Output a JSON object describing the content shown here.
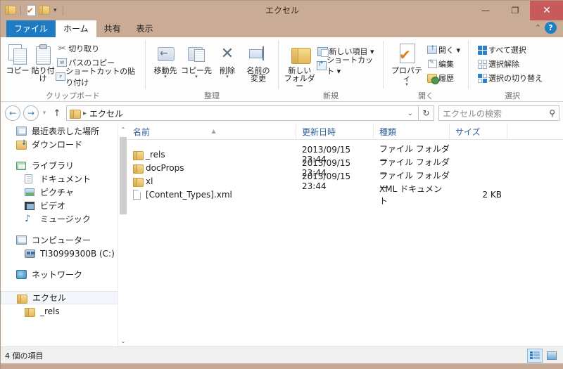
{
  "window": {
    "title": "エクセル",
    "controls": {
      "minimize": "—",
      "maximize": "❐",
      "close": "✕"
    },
    "quick_access": [
      "folder-icon",
      "properties-icon",
      "folder-icon",
      "customize-caret"
    ]
  },
  "tabs": [
    {
      "label": "ファイル",
      "active": false,
      "kind": "file"
    },
    {
      "label": "ホーム",
      "active": true,
      "kind": "normal"
    },
    {
      "label": "共有",
      "active": false,
      "kind": "normal"
    },
    {
      "label": "表示",
      "active": false,
      "kind": "normal"
    }
  ],
  "help_button": "?",
  "ribbon": {
    "groups": [
      {
        "label": "クリップボード",
        "big_buttons": [
          {
            "label": "コピー",
            "icon": "copy-icon"
          },
          {
            "label": "貼り付け",
            "icon": "clipboard-icon"
          }
        ],
        "small_buttons": [
          {
            "label": "切り取り",
            "icon": "scissors-icon"
          },
          {
            "label": "パスのコピー",
            "icon": "copy-path-icon"
          },
          {
            "label": "ショートカットの貼り付け",
            "icon": "paste-shortcut-icon"
          }
        ]
      },
      {
        "label": "整理",
        "big_buttons": [
          {
            "label": "移動先",
            "icon": "move-to-icon",
            "caret": true
          },
          {
            "label": "コピー先",
            "icon": "copy-to-icon",
            "caret": true
          },
          {
            "label": "削除",
            "icon": "delete-icon",
            "caret": true
          },
          {
            "label": "名前の\n変更",
            "icon": "rename-icon",
            "caret": false
          }
        ],
        "small_buttons": []
      },
      {
        "label": "新規",
        "big_buttons": [
          {
            "label": "新しい\nフォルダー",
            "icon": "new-folder-icon",
            "caret": false
          }
        ],
        "small_buttons": [
          {
            "label": "新しい項目 ▾",
            "icon": "new-item-icon"
          },
          {
            "label": "ショートカット ▾",
            "icon": "shortcut-icon"
          }
        ]
      },
      {
        "label": "開く",
        "big_buttons": [
          {
            "label": "プロパティ",
            "icon": "properties-icon",
            "caret": true
          }
        ],
        "small_buttons": [
          {
            "label": "開く ▾",
            "icon": "open-icon"
          },
          {
            "label": "編集",
            "icon": "edit-icon"
          },
          {
            "label": "履歴",
            "icon": "history-icon"
          }
        ]
      },
      {
        "label": "選択",
        "big_buttons": [],
        "small_buttons": [
          {
            "label": "すべて選択",
            "icon": "select-all-icon"
          },
          {
            "label": "選択解除",
            "icon": "select-none-icon"
          },
          {
            "label": "選択の切り替え",
            "icon": "invert-selection-icon"
          }
        ]
      }
    ]
  },
  "address_bar": {
    "back": "←",
    "forward": "→",
    "recent_caret": "▾",
    "up": "↑",
    "crumb_icon": "folder-icon",
    "crumb_sep": "▸",
    "path": "エクセル",
    "dropdown_caret": "⌄",
    "refresh": "↻"
  },
  "search": {
    "placeholder": "エクセルの検索",
    "icon": "magnifier-icon"
  },
  "nav_pane": {
    "items": [
      {
        "label": "最近表示した場所",
        "icon": "recent-places-icon",
        "level": 1,
        "selected": false
      },
      {
        "label": "ダウンロード",
        "icon": "downloads-icon",
        "level": 1,
        "selected": false
      },
      {
        "gap": true
      },
      {
        "label": "ライブラリ",
        "icon": "library-icon",
        "level": 1,
        "selected": false
      },
      {
        "label": "ドキュメント",
        "icon": "documents-icon",
        "level": 2,
        "selected": false
      },
      {
        "label": "ピクチャ",
        "icon": "pictures-icon",
        "level": 2,
        "selected": false
      },
      {
        "label": "ビデオ",
        "icon": "videos-icon",
        "level": 2,
        "selected": false
      },
      {
        "label": "ミュージック",
        "icon": "music-icon",
        "level": 2,
        "selected": false
      },
      {
        "gap": true
      },
      {
        "label": "コンピューター",
        "icon": "computer-icon",
        "level": 1,
        "selected": false
      },
      {
        "label": "TI30999300B (C:)",
        "icon": "drive-icon",
        "level": 2,
        "selected": false
      },
      {
        "gap": true
      },
      {
        "label": "ネットワーク",
        "icon": "network-icon",
        "level": 1,
        "selected": false
      },
      {
        "gap": true
      },
      {
        "label": "エクセル",
        "icon": "folder-icon",
        "level": 1,
        "selected": true
      },
      {
        "label": "_rels",
        "icon": "folder-icon",
        "level": 2,
        "selected": false
      }
    ],
    "scrollbar": {
      "up": "⌃",
      "down": "⌄"
    }
  },
  "file_list": {
    "columns": [
      {
        "label": "名前",
        "sorted": true,
        "sort_mark": "▲"
      },
      {
        "label": "更新日時",
        "sorted": false,
        "sort_mark": ""
      },
      {
        "label": "種類",
        "sorted": false,
        "sort_mark": ""
      },
      {
        "label": "サイズ",
        "sorted": false,
        "sort_mark": ""
      }
    ],
    "rows": [
      {
        "name": "_rels",
        "icon": "folder-icon",
        "date": "2013/09/15 23:44",
        "type": "ファイル フォルダー",
        "size": ""
      },
      {
        "name": "docProps",
        "icon": "folder-icon",
        "date": "2013/09/15 23:44",
        "type": "ファイル フォルダー",
        "size": ""
      },
      {
        "name": "xl",
        "icon": "folder-icon",
        "date": "2013/09/15 23:44",
        "type": "ファイル フォルダー",
        "size": ""
      },
      {
        "name": "[Content_Types].xml",
        "icon": "xml-document-icon",
        "date": "",
        "type": "XML ドキュメント",
        "size": "2 KB"
      }
    ]
  },
  "status_bar": {
    "item_count": "4 個の項目",
    "views": [
      {
        "name": "details-view",
        "active": true
      },
      {
        "name": "thumbnails-view",
        "active": false
      }
    ]
  }
}
